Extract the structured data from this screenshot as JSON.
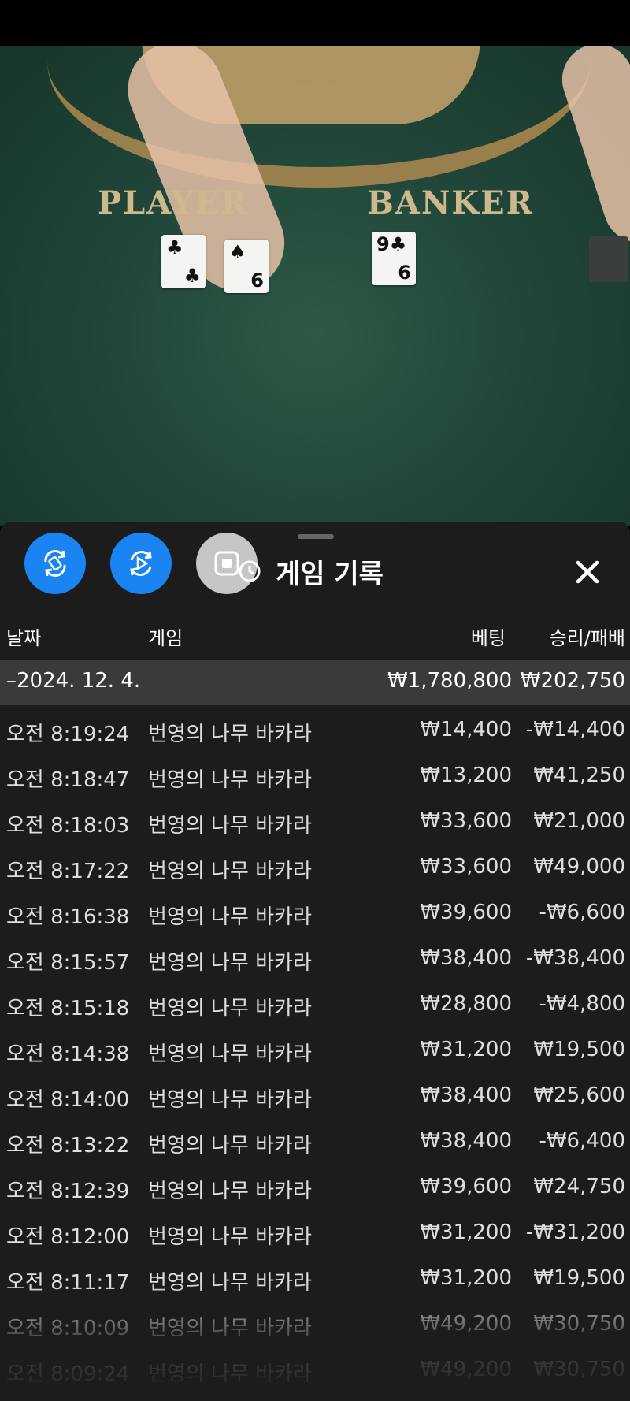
{
  "video": {
    "player_label": "PLAYER",
    "banker_label": "BANKER"
  },
  "sheet": {
    "title": "게임 기록",
    "columns": {
      "date": "날짜",
      "game": "게임",
      "bet": "베팅",
      "result": "승리/패배"
    },
    "summary": {
      "date": "–2024. 12. 4.",
      "bet_total": "₩1,780,800",
      "result_total": "₩202,750"
    },
    "rows": [
      {
        "time": "오전 8:19:24",
        "game": "번영의 나무 바카라",
        "bet": "₩14,400",
        "result": "-₩14,400"
      },
      {
        "time": "오전 8:18:47",
        "game": "번영의 나무 바카라",
        "bet": "₩13,200",
        "result": "₩41,250"
      },
      {
        "time": "오전 8:18:03",
        "game": "번영의 나무 바카라",
        "bet": "₩33,600",
        "result": "₩21,000"
      },
      {
        "time": "오전 8:17:22",
        "game": "번영의 나무 바카라",
        "bet": "₩33,600",
        "result": "₩49,000"
      },
      {
        "time": "오전 8:16:38",
        "game": "번영의 나무 바카라",
        "bet": "₩39,600",
        "result": "-₩6,600"
      },
      {
        "time": "오전 8:15:57",
        "game": "번영의 나무 바카라",
        "bet": "₩38,400",
        "result": "-₩38,400"
      },
      {
        "time": "오전 8:15:18",
        "game": "번영의 나무 바카라",
        "bet": "₩28,800",
        "result": "-₩4,800"
      },
      {
        "time": "오전 8:14:38",
        "game": "번영의 나무 바카라",
        "bet": "₩31,200",
        "result": "₩19,500"
      },
      {
        "time": "오전 8:14:00",
        "game": "번영의 나무 바카라",
        "bet": "₩38,400",
        "result": "₩25,600"
      },
      {
        "time": "오전 8:13:22",
        "game": "번영의 나무 바카라",
        "bet": "₩38,400",
        "result": "-₩6,400"
      },
      {
        "time": "오전 8:12:39",
        "game": "번영의 나무 바카라",
        "bet": "₩39,600",
        "result": "₩24,750"
      },
      {
        "time": "오전 8:12:00",
        "game": "번영의 나무 바카라",
        "bet": "₩31,200",
        "result": "-₩31,200"
      },
      {
        "time": "오전 8:11:17",
        "game": "번영의 나무 바카라",
        "bet": "₩31,200",
        "result": "₩19,500"
      },
      {
        "time": "오전 8:10:09",
        "game": "번영의 나무 바카라",
        "bet": "₩49,200",
        "result": "₩30,750"
      },
      {
        "time": "오전 8:09:24",
        "game": "번영의 나무 바카라",
        "bet": "₩49,200",
        "result": "₩30,750"
      }
    ]
  },
  "icons": {
    "rotate": "rotate-icon",
    "replay": "replay-icon",
    "stop": "stop-icon",
    "history": "history-icon",
    "close": "close-icon"
  },
  "colors": {
    "accent": "#1a84f3",
    "felt": "#21473a",
    "sheet_bg": "#1c1c1c",
    "summary_bg": "#3a3a3a"
  }
}
